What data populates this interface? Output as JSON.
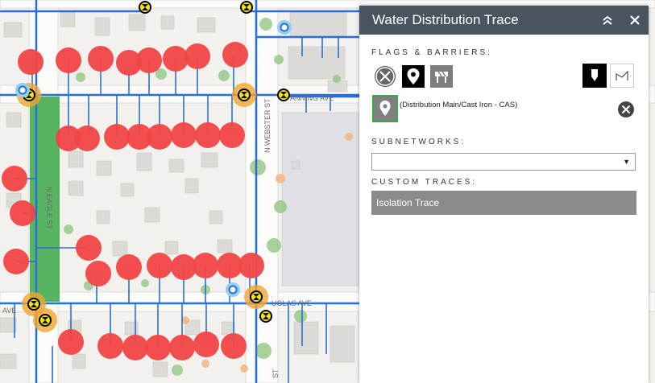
{
  "map": {
    "street_labels": [
      "N EAGLE ST",
      "N WEBSTER ST",
      "ANNING AVE",
      "UGLAS AVE",
      "AVE",
      "ST"
    ]
  },
  "panel": {
    "title": "Water Distribution Trace",
    "flags_label": "FLAGS & BARRIERS:",
    "flag_entry_text": "(Distribution Main/Cast Iron - CAS)",
    "subnetworks_label": "SUBNETWORKS:",
    "subnetwork_selected": "",
    "custom_traces_label": "CUSTOM TRACES:",
    "custom_trace_button": "Isolation Trace"
  },
  "colors": {
    "header_bg": "#4a5461",
    "trace_button_bg": "#8b8b8b",
    "pipe": "#2b6fd6",
    "isolation_point": "#f24545",
    "valve_halo": "#f0a630",
    "selected_main": "#3aa845"
  },
  "icons": [
    "collapse-icon",
    "close-icon",
    "clear-icon",
    "flag-pin-icon",
    "barrier-icon",
    "point-mode-icon",
    "polygon-mode-icon",
    "remove-flag-icon"
  ]
}
